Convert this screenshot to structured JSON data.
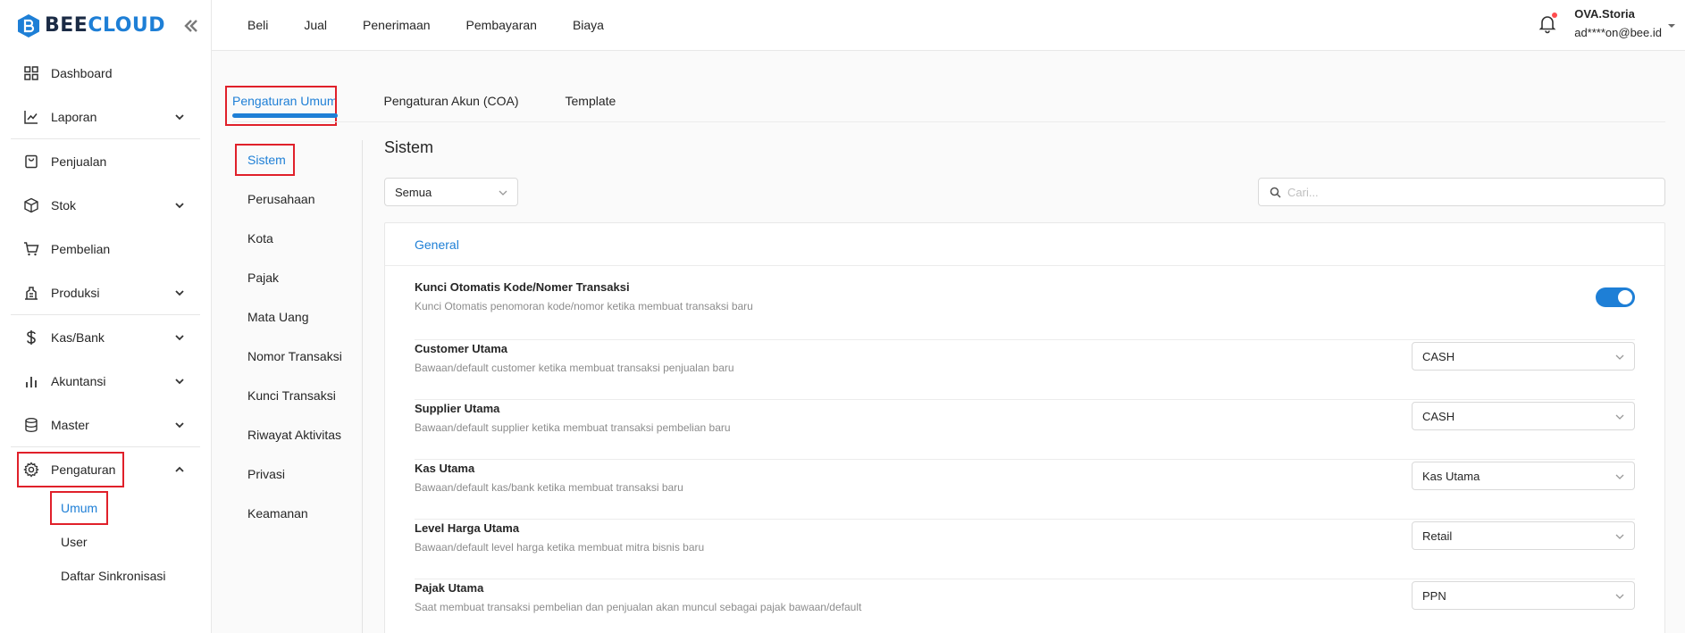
{
  "brand": {
    "part1": "BEE",
    "part2": "CLOUD",
    "blue": "#1e7fd6",
    "dark": "#1b2b45"
  },
  "sidebar": {
    "items": [
      {
        "label": "Dashboard",
        "icon": "dashboard-icon"
      },
      {
        "label": "Laporan",
        "icon": "chart-line-icon",
        "expandable": true
      },
      {
        "label": "Penjualan",
        "icon": "shopping-bag-icon"
      },
      {
        "label": "Stok",
        "icon": "box-icon",
        "expandable": true
      },
      {
        "label": "Pembelian",
        "icon": "cart-icon"
      },
      {
        "label": "Produksi",
        "icon": "factory-icon",
        "expandable": true
      },
      {
        "label": "Kas/Bank",
        "icon": "dollar-icon",
        "expandable": true
      },
      {
        "label": "Akuntansi",
        "icon": "bar-chart-icon",
        "expandable": true
      },
      {
        "label": "Master",
        "icon": "database-icon",
        "expandable": true
      },
      {
        "label": "Pengaturan",
        "icon": "gear-icon",
        "expandable": true,
        "expanded": true
      }
    ],
    "sub_items": [
      {
        "label": "Umum",
        "active": true
      },
      {
        "label": "User"
      },
      {
        "label": "Daftar Sinkronisasi"
      }
    ]
  },
  "topbar": {
    "menu": [
      "Beli",
      "Jual",
      "Penerimaan",
      "Pembayaran",
      "Biaya"
    ],
    "user_name": "OVA.Storia",
    "user_email": "ad****on@bee.id"
  },
  "tabs": [
    "Pengaturan Umum",
    "Pengaturan Akun (COA)",
    "Template"
  ],
  "subnav": [
    "Sistem",
    "Perusahaan",
    "Kota",
    "Pajak",
    "Mata Uang",
    "Nomor Transaksi",
    "Kunci Transaksi",
    "Riwayat Aktivitas",
    "Privasi",
    "Keamanan"
  ],
  "content": {
    "title": "Sistem",
    "filter_value": "Semua",
    "search_placeholder": "Cari...",
    "section": "General",
    "settings": [
      {
        "title": "Kunci Otomatis Kode/Nomer Transaksi",
        "desc": "Kunci Otomatis penomoran kode/nomor ketika membuat transaksi baru",
        "control": "toggle",
        "on": true
      },
      {
        "title": "Customer Utama",
        "desc": "Bawaan/default customer ketika membuat transaksi penjualan baru",
        "control": "select",
        "value": "CASH"
      },
      {
        "title": "Supplier Utama",
        "desc": "Bawaan/default supplier ketika membuat transaksi pembelian baru",
        "control": "select",
        "value": "CASH"
      },
      {
        "title": "Kas Utama",
        "desc": "Bawaan/default kas/bank ketika membuat transaksi baru",
        "control": "select",
        "value": "Kas Utama"
      },
      {
        "title": "Level Harga Utama",
        "desc": "Bawaan/default level harga ketika membuat mitra bisnis baru",
        "control": "select",
        "value": "Retail"
      },
      {
        "title": "Pajak Utama",
        "desc": "Saat membuat transaksi pembelian dan penjualan akan muncul sebagai pajak bawaan/default",
        "control": "select",
        "value": "PPN"
      }
    ]
  },
  "colors": {
    "accent": "#1e7fd6",
    "highlight_box": "#e0202a",
    "notification_dot": "#ff4d4f"
  }
}
